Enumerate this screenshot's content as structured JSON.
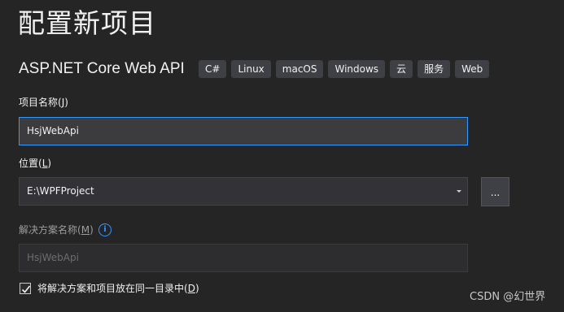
{
  "page": {
    "title": "配置新项目",
    "template_name": "ASP.NET Core Web API",
    "tags": [
      "C#",
      "Linux",
      "macOS",
      "Windows",
      "云",
      "服务",
      "Web"
    ]
  },
  "project_name": {
    "label": "项目名称",
    "hotkey": "J",
    "value": "HsjWebApi"
  },
  "location": {
    "label": "位置",
    "hotkey": "L",
    "value": "E:\\WPFProject",
    "browse_label": "..."
  },
  "solution_name": {
    "label": "解决方案名称",
    "hotkey": "M",
    "value": "HsjWebApi",
    "info_icon": "info-icon"
  },
  "same_directory": {
    "label": "将解决方案和项目放在同一目录中",
    "hotkey": "D",
    "checked": true
  },
  "watermark": "CSDN @幻世界",
  "colors": {
    "background": "#252526",
    "focus_border": "#3399ff",
    "info": "#3794ff"
  }
}
